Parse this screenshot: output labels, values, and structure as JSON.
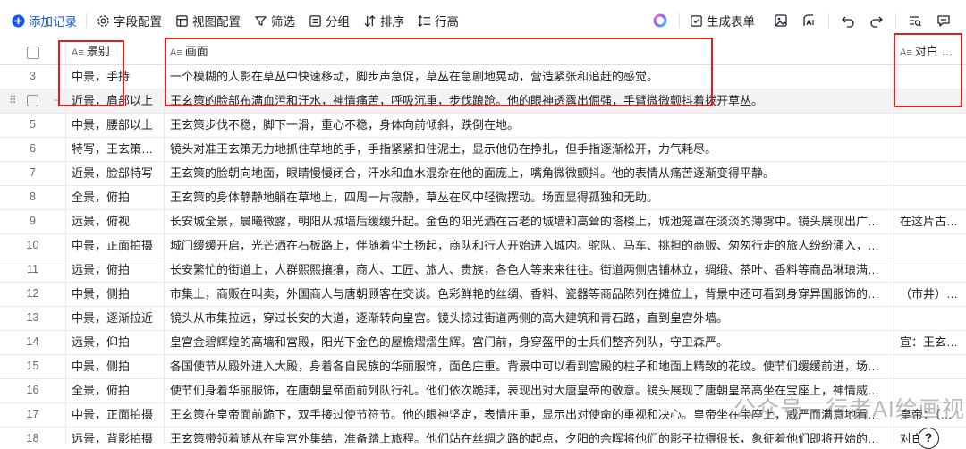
{
  "toolbar": {
    "add_record": "添加记录",
    "field_config": "字段配置",
    "view_config": "视图配置",
    "filter": "筛选",
    "group": "分组",
    "sort": "排序",
    "row_height": "行高",
    "generate_form": "生成表单"
  },
  "columns": {
    "shot": "景别",
    "picture": "画面",
    "dialogue": "对白 旁白"
  },
  "rows": [
    {
      "num": "3",
      "shot": "中景，手持",
      "picture": "一个模糊的人影在草丛中快速移动，脚步声急促，草丛在急剧地晃动，营造紧张和追赶的感觉。",
      "dialogue": ""
    },
    {
      "num": "",
      "shot": "近景，肩部以上",
      "picture": "王玄策的脸部布满血污和汗水，神情痛苦，呼吸沉重，步伐踉跄。他的眼神透露出倔强，手臂微微颤抖着拨开草丛。",
      "dialogue": ""
    },
    {
      "num": "5",
      "shot": "中景，腰部以上",
      "picture": "王玄策步伐不稳，脚下一滑，重心不稳，身体向前倾斜，跌倒在地。",
      "dialogue": ""
    },
    {
      "num": "6",
      "shot": "特写，王玄策…",
      "picture": "镜头对准王玄策无力地抓住草地的手，手指紧紧扣住泥土，显示他仍在挣扎，但手指逐渐松开，力气耗尽。",
      "dialogue": ""
    },
    {
      "num": "7",
      "shot": "近景，脸部特写",
      "picture": "王玄策的脸朝向地面，眼睛慢慢闭合，汗水和血水混杂在他的面庞上，嘴角微微颤抖。他的表情从痛苦逐渐变得平静。",
      "dialogue": ""
    },
    {
      "num": "8",
      "shot": "全景，俯拍",
      "picture": "王玄策的身体静静地躺在草地上，四周一片寂静，草丛在风中轻微摆动。场面显得孤独和无助。",
      "dialogue": ""
    },
    {
      "num": "9",
      "shot": "远景，俯视",
      "picture": "长安城全景，晨曦微露，朝阳从城墙后缓缓升起。金色的阳光洒在古老的城墙和高耸的塔楼上，城池笼罩在淡淡的薄雾中。镜头展现出广阔的地平线和…",
      "dialogue": "在这片古老的"
    },
    {
      "num": "10",
      "shot": "中景，正面拍摄",
      "picture": "城门缓缓开启，光芒洒在石板路上，伴随着尘土扬起，商队和行人开始进入城内。驼队、马车、挑担的商贩、匆匆行走的旅人纷纷涌入，象征繁华的景…",
      "dialogue": ""
    },
    {
      "num": "11",
      "shot": "远景，俯拍",
      "picture": "长安繁忙的街道上，人群熙熙攘攘，商人、工匠、旅人、贵族，各色人等来来往往。街道两侧店铺林立，绸缎、茶叶、香料等商品琳琅满目，热闹非凡…",
      "dialogue": ""
    },
    {
      "num": "12",
      "shot": "中景，侧拍",
      "picture": "市集上，商贩在叫卖，外国商人与唐朝顾客在交谈。色彩鲜艳的丝绸、香料、瓷器等商品陈列在摊位上，背景中还可看到身穿异国服饰的商人，与中国…",
      "dialogue": "（市井）上好的"
    },
    {
      "num": "13",
      "shot": "中景，逐渐拉近",
      "picture": "镜头从市集拉远，穿过长安的大道，逐渐转向皇宫。镜头掠过街道两侧的高大建筑和青石路，直到皇宫外墙。",
      "dialogue": ""
    },
    {
      "num": "14",
      "shot": "远景，仰拍",
      "picture": "皇宫金碧辉煌的高墙和宫殿，阳光下金色的屋檐熠熠生辉。宫门前，身穿盔甲的士兵们整齐列队，守卫森严。",
      "dialogue": "宣：王玄策入"
    },
    {
      "num": "15",
      "shot": "中景，侧拍",
      "picture": "各国使节从殿外进入大殿，身着各自民族的华丽服饰，面色庄重。背景中可以看到宫殿的柱子和地面上精致的花纹。使节们缓缓前进，场面肃穆庄严。",
      "dialogue": ""
    },
    {
      "num": "16",
      "shot": "全景，俯拍",
      "picture": "使节们身着华丽服饰，在唐朝皇帝面前列队行礼。他们依次跪拜，表现出对大唐皇帝的敬意。镜头展现了唐朝皇帝高坐在宝座上，神情威严，背景中的…",
      "dialogue": ""
    },
    {
      "num": "17",
      "shot": "中景，正面拍摄",
      "picture": "王玄策在皇帝面前跪下，双手接过使节符节。他的眼神坚定，表情庄重，显示出对使命的重视和决心。皇帝坐在宝座上，威严而满意地看着王玄策，周…",
      "dialogue": "皇帝：（威严"
    },
    {
      "num": "18",
      "shot": "远景，背影拍摄",
      "picture": "王玄策带领着随从在皇宫外集结，准备踏上旅程。他们站在丝绸之路的起点，夕阳的余晖将他们的影子拉得很长，象征着他们即将开始的漫长旅程。两…",
      "dialogue": "对白："
    }
  ],
  "watermark": "公众号 · 行者AI绘画视频",
  "help_label": "?"
}
